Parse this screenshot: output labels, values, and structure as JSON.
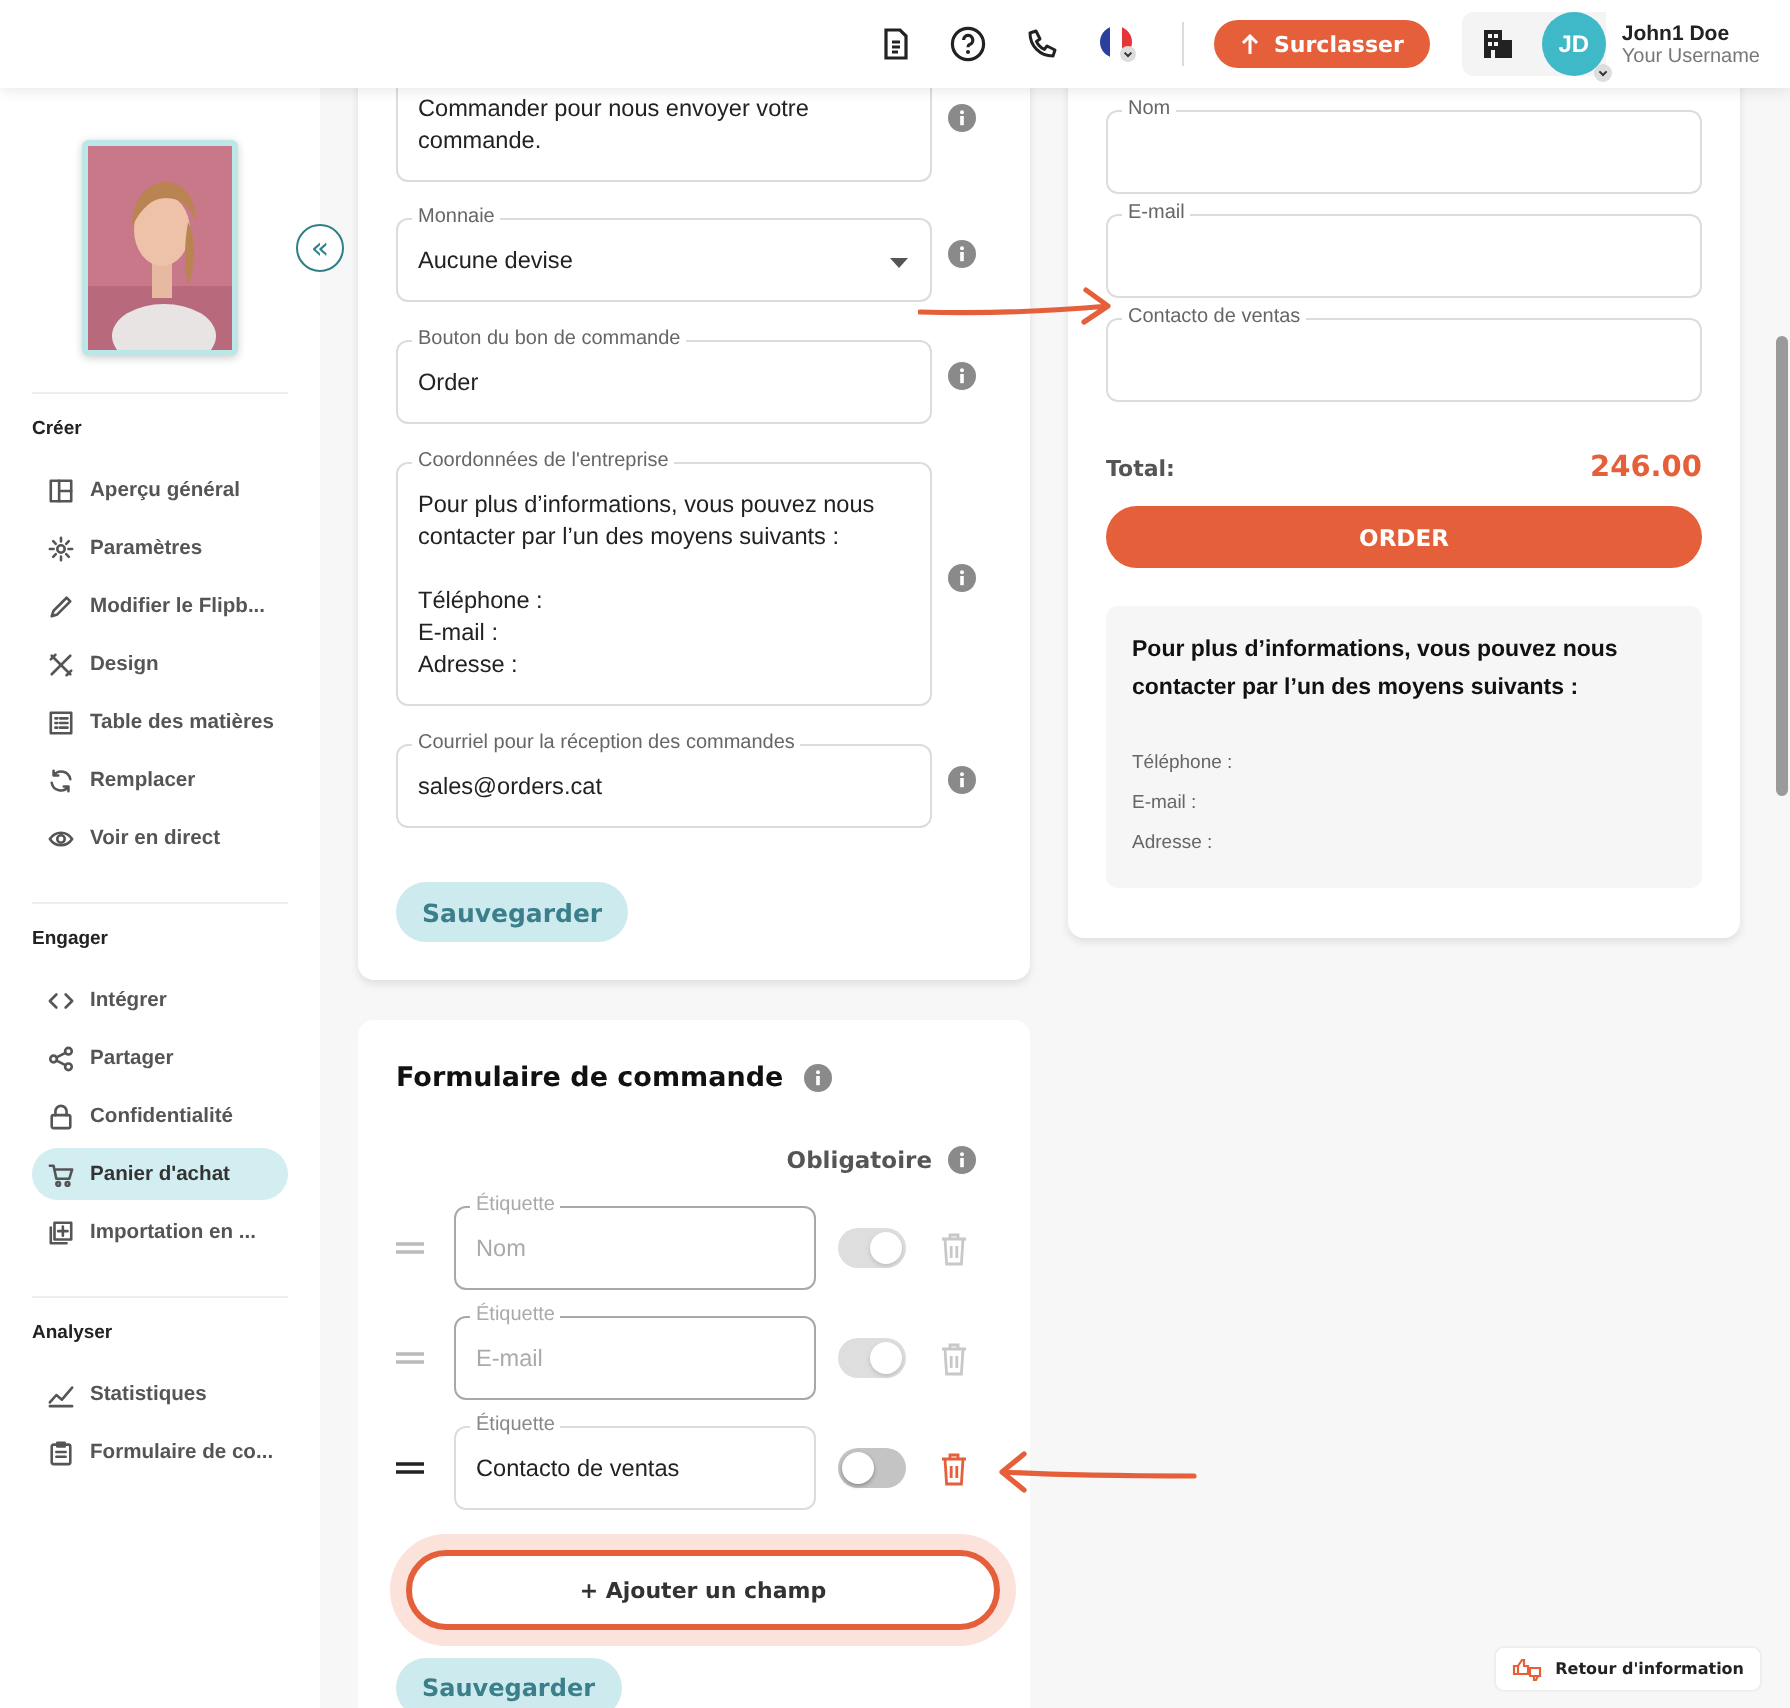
{
  "header": {
    "upgrade_button": "Surclasser",
    "user": {
      "initials": "JD",
      "name": "John1 Doe",
      "username": "Your Username"
    }
  },
  "sidebar": {
    "collapse_button": "«",
    "sections": [
      {
        "title": "Créer",
        "items": [
          {
            "label": "Aperçu général",
            "selected": false
          },
          {
            "label": "Paramètres",
            "selected": false
          },
          {
            "label": "Modifier le Flipb...",
            "selected": false
          },
          {
            "label": "Design",
            "selected": false
          },
          {
            "label": "Table des matières",
            "selected": false
          },
          {
            "label": "Remplacer",
            "selected": false
          },
          {
            "label": "Voir en direct",
            "selected": false
          }
        ]
      },
      {
        "title": "Engager",
        "items": [
          {
            "label": "Intégrer",
            "selected": false
          },
          {
            "label": "Partager",
            "selected": false
          },
          {
            "label": "Confidentialité",
            "selected": false
          },
          {
            "label": "Panier d'achat",
            "selected": true
          },
          {
            "label": "Importation en ...",
            "selected": false
          }
        ]
      },
      {
        "title": "Analyser",
        "items": [
          {
            "label": "Statistiques",
            "selected": false
          },
          {
            "label": "Formulaire de co...",
            "selected": false
          }
        ]
      }
    ]
  },
  "settings_card": {
    "fields": [
      {
        "kind": "textarea",
        "value": "Commander pour nous envoyer votre commande."
      },
      {
        "kind": "select",
        "label": "Monnaie",
        "value": "Aucune devise"
      },
      {
        "kind": "text",
        "label": "Bouton du bon de commande",
        "value": "Order"
      },
      {
        "kind": "textarea",
        "label": "Coordonnées de l'entreprise",
        "value": "Pour plus d’informations, vous pouvez nous contacter par l’un des moyens suivants :\n\nTéléphone :\nE-mail :\nAdresse :"
      },
      {
        "kind": "text",
        "label": "Courriel pour la réception des commandes",
        "value": "sales@orders.cat"
      }
    ],
    "save_button": "Sauvegarder"
  },
  "order_form": {
    "title": "Formulaire de commande",
    "required_heading": "Obligatoire",
    "rows": [
      {
        "label": "Étiquette",
        "value": "Nom",
        "disabled": true,
        "required": true
      },
      {
        "label": "Étiquette",
        "value": "E-mail",
        "disabled": true,
        "required": true
      },
      {
        "label": "Étiquette",
        "value": "Contacto de ventas",
        "disabled": false,
        "required": false
      }
    ],
    "add_button": "+ Ajouter un champ",
    "save_button": "Sauvegarder"
  },
  "preview": {
    "fields": [
      {
        "label": "Nom"
      },
      {
        "label": "E-mail"
      },
      {
        "label": "Contacto de ventas"
      }
    ],
    "total_label": "Total:",
    "total": "246.00",
    "order_button": "ORDER",
    "info": {
      "heading": "Pour plus d’informations, vous pouvez nous contacter par l’un des moyens suivants :",
      "lines": [
        "Téléphone :",
        "E-mail :",
        "Adresse :"
      ]
    }
  },
  "feedback_button": "Retour d'information"
}
